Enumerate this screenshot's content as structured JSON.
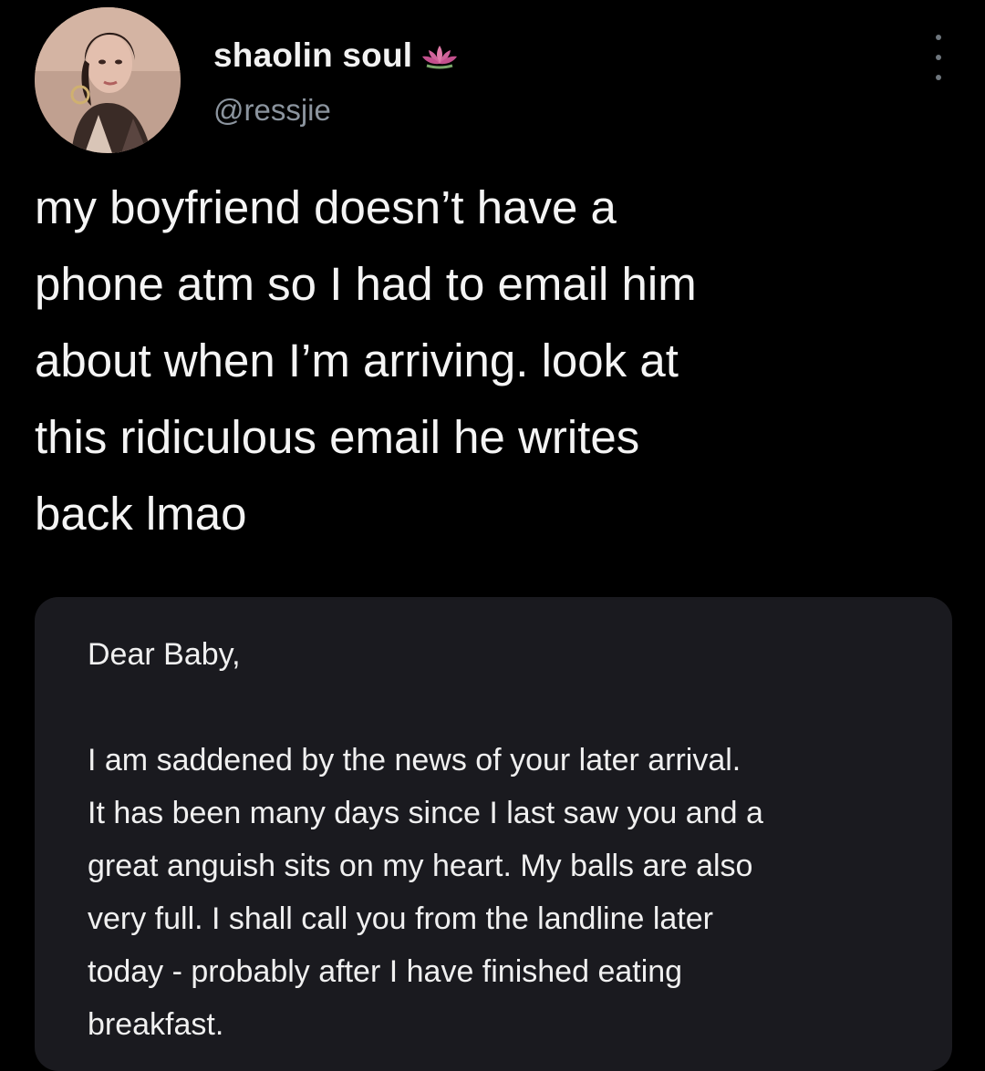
{
  "tweet": {
    "author": {
      "display_name": "shaolin soul",
      "handle": "@ressjie",
      "avatar_icon": "profile-photo",
      "badge_icon": "lotus-emoji"
    },
    "text": "my boyfriend doesn’t have a\nphone atm so I had to email him\nabout when I’m arriving. look at\nthis ridiculous email he writes\nback lmao",
    "more_icon": "vertical-ellipsis-icon"
  },
  "email": {
    "greeting": "Dear Baby,",
    "body": "I am saddened by the news of your later arrival.\nIt has been many days since I last saw you and a\ngreat anguish sits on my heart. My balls are also\nvery full. I shall call you from the landline later\ntoday - probably after I have finished eating\nbreakfast."
  },
  "colors": {
    "background": "#000000",
    "card": "#1a1a1f",
    "text_primary": "#f4f4f4",
    "text_secondary": "#8b949e",
    "lotus": "#e07aa8"
  }
}
